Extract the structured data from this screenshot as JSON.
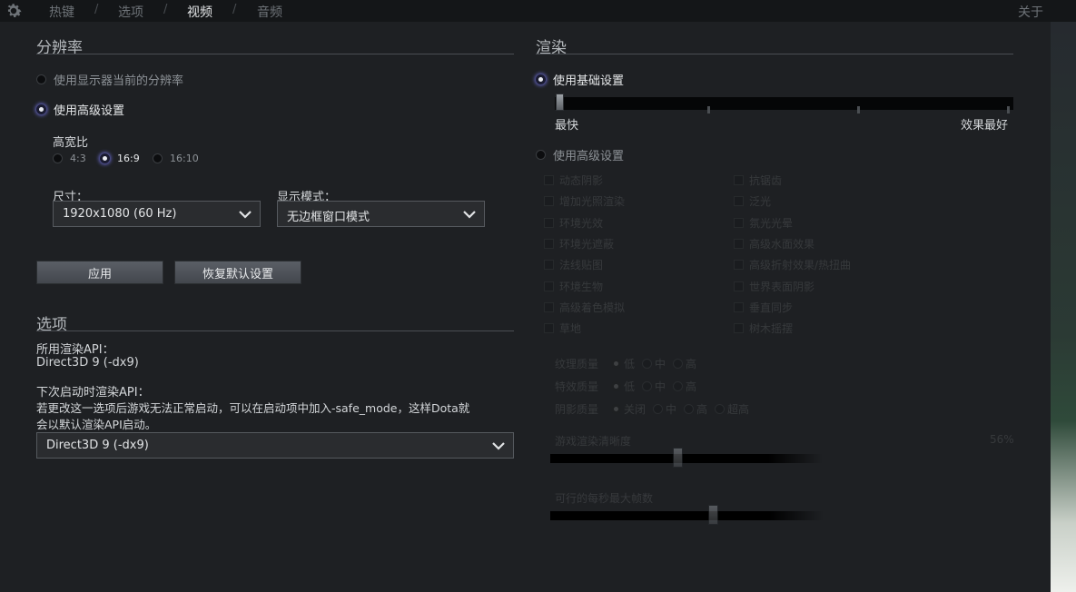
{
  "nav": {
    "tabs": [
      "热键",
      "选项",
      "视频",
      "音频"
    ],
    "active_tab": "视频",
    "about_label": "关于"
  },
  "resolution": {
    "title": "分辨率",
    "use_current_label": "使用显示器当前的分辨率",
    "use_advanced_label": "使用高级设置",
    "aspect_label": "高宽比",
    "aspect_options": [
      "4:3",
      "16:9",
      "16:10"
    ],
    "aspect_selected": "16:9",
    "size_label": "尺寸：",
    "size_value": "1920x1080 (60 Hz)",
    "display_mode_label": "显示模式：",
    "display_mode_value": "无边框窗口模式",
    "apply_label": "应用",
    "restore_label": "恢复默认设置"
  },
  "options": {
    "title": "选项",
    "api_label": "所用渲染API：",
    "api_value": "Direct3D 9 (-dx9)",
    "next_api_label": "下次启动时渲染API：",
    "note_line1": "若更改这一选项后游戏无法正常启动，可以在启动项中加入-safe_mode，这样Dota就",
    "note_line2": "会以默认渲染API启动。",
    "next_api_value": "Direct3D 9 (-dx9)"
  },
  "render": {
    "title": "渲染",
    "basic_label": "使用基础设置",
    "slider_min_label": "最快",
    "slider_max_label": "效果最好",
    "basic_level": 0,
    "advanced_label": "使用高级设置",
    "checkboxes_left": [
      "动态阴影",
      "增加光照渲染",
      "环境光效",
      "环境光遮蔽",
      "法线贴图",
      "环境生物",
      "高级着色模拟",
      "草地"
    ],
    "checkboxes_right": [
      "抗锯齿",
      "泛光",
      "氛光光晕",
      "高级水面效果",
      "高级折射效果/热扭曲",
      "世界表面阴影",
      "垂直同步",
      "树木摇摆"
    ],
    "texture_quality_label": "纹理质量",
    "effects_quality_label": "特效质量",
    "shadow_quality_label": "阴影质量",
    "q_options_3": [
      "低",
      "中",
      "高"
    ],
    "q_options_4": [
      "关闭",
      "中",
      "高",
      "超高"
    ],
    "render_quality_label": "游戏渲染清晰度",
    "render_quality_value": "56%",
    "render_quality_level": 0.45,
    "max_fps_label": "可行的每秒最大帧数",
    "max_fps_level": 0.58
  }
}
